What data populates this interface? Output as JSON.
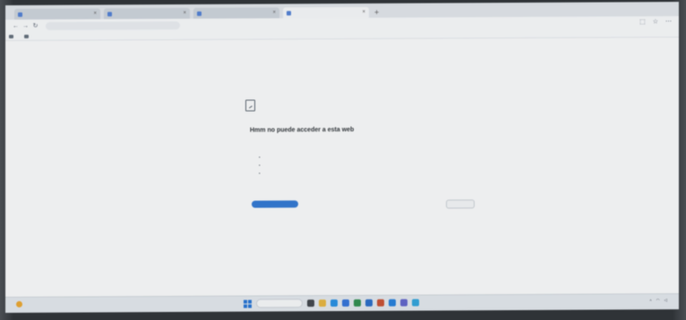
{
  "tabs": [
    {
      "label": ""
    },
    {
      "label": ""
    },
    {
      "label": ""
    },
    {
      "label": ""
    }
  ],
  "address": {
    "url": ""
  },
  "bookmarks": [
    {
      "label": ""
    },
    {
      "label": ""
    }
  ],
  "error": {
    "title": "Hmm no puede acceder a esta web",
    "subtitle": "",
    "try_heading": "",
    "suggestions": [
      "",
      "",
      ""
    ],
    "code": "",
    "reload_label": "",
    "details_label": ""
  },
  "taskbar": {
    "search_placeholder": "",
    "weather_temp": "",
    "weather_desc": "",
    "time": "",
    "date": ""
  },
  "colors": {
    "accent": "#2b73cf",
    "link": "#3e72c4",
    "taskbar": "#dfe4ea"
  }
}
